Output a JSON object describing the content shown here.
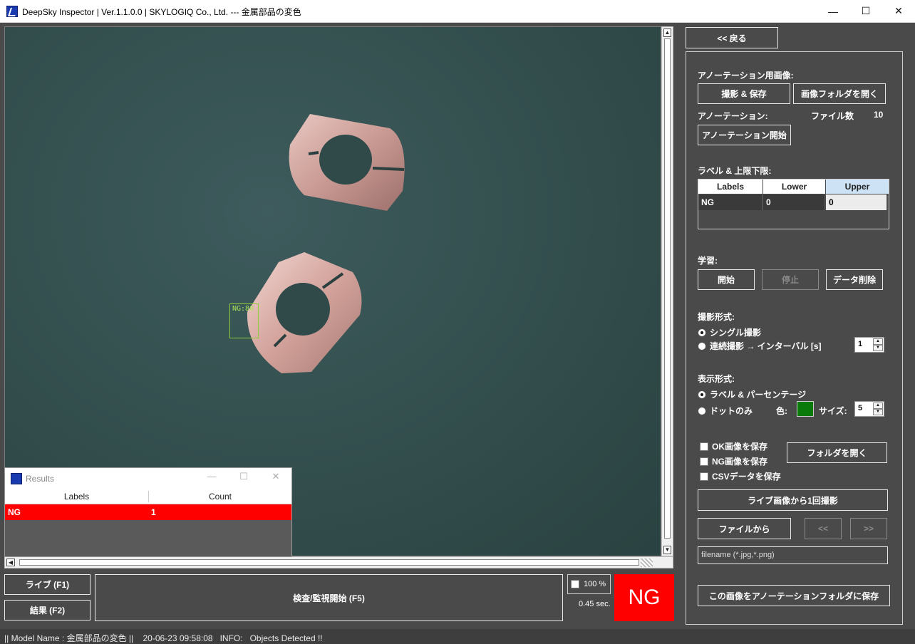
{
  "window": {
    "title": "DeepSky Inspector | Ver.1.1.0.0 | SKYLOGIQ Co., Ltd. --- 金属部品の変色",
    "minimize_glyph": "—",
    "maximize_glyph": "☐",
    "close_glyph": "✕"
  },
  "image_view": {
    "detection": {
      "label": "NG:80"
    }
  },
  "results": {
    "title": "Results",
    "columns": [
      "Labels",
      "Count"
    ],
    "rows": [
      {
        "label": "NG",
        "count": "1"
      }
    ]
  },
  "bottom": {
    "live_button": "ライブ (F1)",
    "result_button": "結果 (F2)",
    "inspect_button": "検査/監視開始 (F5)",
    "zoom_label": "100 %",
    "elapsed": "0.45 sec.",
    "verdict": "NG"
  },
  "status_bar": "|| Model Name : 金属部品の変色 ||    20-06-23 09:58:08   INFO:   Objects Detected !!",
  "right_panel": {
    "back_button": "<< 戻る",
    "annotation_images_label": "アノーテーション用画像:",
    "capture_save_button": "撮影 & 保存",
    "open_image_folder_button": "画像フォルダを開く",
    "annotation_label": "アノーテーション:",
    "file_count_label": "ファイル数",
    "file_count": "10",
    "annotation_start_button": "アノーテーション開始",
    "labels_limits_label": "ラベル & 上限下限:",
    "labels_table": {
      "columns": [
        "Labels",
        "Lower",
        "Upper"
      ],
      "rows": [
        {
          "label": "NG",
          "lower": "0",
          "upper": "0"
        }
      ]
    },
    "learning_label": "学習:",
    "start_button": "開始",
    "stop_button": "停止",
    "delete_data_button": "データ削除",
    "capture_mode_label": "撮影形式:",
    "single_capture": "シングル撮影",
    "continuous_capture": "連続撮影 → インターバル [s]",
    "interval_value": "1",
    "display_mode_label": "表示形式:",
    "label_percentage": "ラベル & パーセンテージ",
    "dots_only": "ドットのみ",
    "color_label": "色:",
    "dot_color": "#0a7a0a",
    "size_label": "サイズ:",
    "size_value": "5",
    "save_ok": "OK画像を保存",
    "save_ng": "NG画像を保存",
    "save_csv": "CSVデータを保存",
    "open_folder_button": "フォルダを開く",
    "capture_once_button": "ライブ画像から1回撮影",
    "from_file_button": "ファイルから",
    "prev_button": "<<",
    "next_button": ">>",
    "filename_placeholder": "filename (*.jpg,*.png)",
    "save_to_annotation_button": "この画像をアノーテーションフォルダに保存"
  }
}
